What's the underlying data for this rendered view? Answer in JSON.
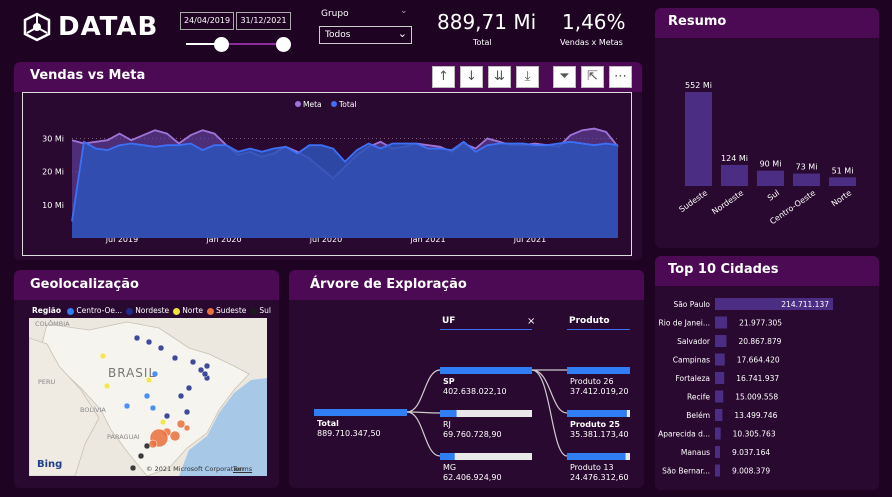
{
  "brand": {
    "name": "DATAB"
  },
  "filters": {
    "date_start": "24/04/2019",
    "date_end": "31/12/2021",
    "grupo_label": "Grupo",
    "grupo_value": "Todos"
  },
  "kpis": {
    "total_value": "889,71 Mi",
    "total_label": "Total",
    "pct_value": "1,46%",
    "pct_label": "Vendas x Metas"
  },
  "toolbar": {
    "icons": [
      "arrow-up-icon",
      "arrow-down-icon",
      "double-arrow-down-icon",
      "expand-down-icon",
      "filter-icon",
      "focus-mode-icon",
      "more-options-icon"
    ]
  },
  "vendas": {
    "title": "Vendas vs Meta"
  },
  "chart_data": [
    {
      "type": "area",
      "title": "Vendas vs Meta",
      "series": [
        {
          "name": "Meta",
          "color": "#9e74d8",
          "values": [
            29.5,
            28.5,
            29,
            29.5,
            31.5,
            29.5,
            31,
            32.5,
            31.5,
            28.5,
            31,
            32.5,
            31.5,
            28,
            25,
            26,
            24.5,
            25.5,
            27.5,
            26,
            24,
            21,
            18,
            21.5,
            25,
            27.5,
            29,
            27,
            27.5,
            28.5,
            28,
            27.5,
            26,
            28.5,
            27,
            30,
            29,
            28,
            28,
            28.5,
            28,
            27.5,
            31,
            32.5,
            33,
            32,
            27.5
          ]
        },
        {
          "name": "Total",
          "color": "#3d6ff7",
          "values": [
            5,
            29,
            27,
            26.5,
            28,
            28.5,
            28,
            27.5,
            28,
            28,
            28.5,
            26.5,
            28,
            28,
            26,
            27,
            26,
            27,
            27.5,
            25.5,
            28,
            28,
            27,
            23,
            26.5,
            28.5,
            27,
            28.5,
            28.5,
            28.5,
            27,
            27,
            26.5,
            29,
            26,
            28,
            28.5,
            28.5,
            28.5,
            28,
            28,
            28.5,
            29,
            28.5,
            28,
            28.5,
            28
          ]
        }
      ],
      "x_ticks": [
        "jul 2019",
        "jan 2020",
        "jul 2020",
        "jan 2021",
        "jul 2021"
      ],
      "y_ticks": [
        "10 Mi",
        "20 Mi",
        "30 Mi"
      ],
      "ylim": [
        0,
        38
      ],
      "legend": "top-center",
      "grid": true
    },
    {
      "type": "bar",
      "title": "Resumo",
      "categories": [
        "Sudeste",
        "Nordeste",
        "Sul",
        "Centro-Oeste",
        "Norte"
      ],
      "values": [
        552,
        124,
        90,
        73,
        51
      ],
      "labels": [
        "552 Mi",
        "124 Mi",
        "90 Mi",
        "73 Mi",
        "51 Mi"
      ],
      "color": "#4b2e83"
    },
    {
      "type": "bar",
      "title": "Top 10 Cidades",
      "orientation": "horizontal",
      "categories": [
        "São Paulo",
        "Rio de Janei...",
        "Salvador",
        "Campinas",
        "Fortaleza",
        "Recife",
        "Belém",
        "Aparecida d...",
        "Manaus",
        "São Bernar..."
      ],
      "values": [
        214711137,
        21977305,
        20867879,
        17664420,
        16741937,
        15009558,
        13499746,
        10305763,
        9037164,
        9008379
      ],
      "labels": [
        "214.711.137",
        "21.977.305",
        "20.867.879",
        "17.664.420",
        "16.741.937",
        "15.009.558",
        "13.499.746",
        "10.305.763",
        "9.037.164",
        "9.008.379"
      ],
      "color": "#4b2e83"
    }
  ],
  "resumo": {
    "title": "Resumo"
  },
  "cidades": {
    "title": "Top 10 Cidades"
  },
  "geo": {
    "title": "Geolocalização",
    "legend_label": "Região",
    "legend": [
      {
        "name": "Centro-Oe...",
        "color": "#2f7ef4"
      },
      {
        "name": "Nordeste",
        "color": "#1f2b8a"
      },
      {
        "name": "Norte",
        "color": "#f2e33a"
      },
      {
        "name": "Sudeste",
        "color": "#e8703b"
      },
      {
        "name": "Sul",
        "color": "#1a1a1a"
      }
    ],
    "map_labels": [
      "COLÔMBIA",
      "BRASIL",
      "PERU",
      "BOLÍVIA",
      "PARAGUAI"
    ],
    "bing": "Bing",
    "copyright": "© 2021 Microsoft Corporation",
    "terms": "Terms"
  },
  "tree": {
    "title": "Árvore de Exploração",
    "uf_label": "UF",
    "produto_label": "Produto",
    "close": "×",
    "root": {
      "name": "Total",
      "value": "889.710.347,50"
    },
    "uf": [
      {
        "name": "SP",
        "value": "402.638.022,10",
        "fill": 1.0
      },
      {
        "name": "RJ",
        "value": "69.760.728,90",
        "fill": 0.18
      },
      {
        "name": "MG",
        "value": "62.406.924,90",
        "fill": 0.16
      }
    ],
    "produtos": [
      {
        "name": "Produto 26",
        "value": "37.412.019,20",
        "fill": 1.0
      },
      {
        "name": "Produto 25",
        "value": "35.381.173,40",
        "fill": 0.95
      },
      {
        "name": "Produto 13",
        "value": "24.476.312,60",
        "fill": 0.93
      }
    ]
  }
}
